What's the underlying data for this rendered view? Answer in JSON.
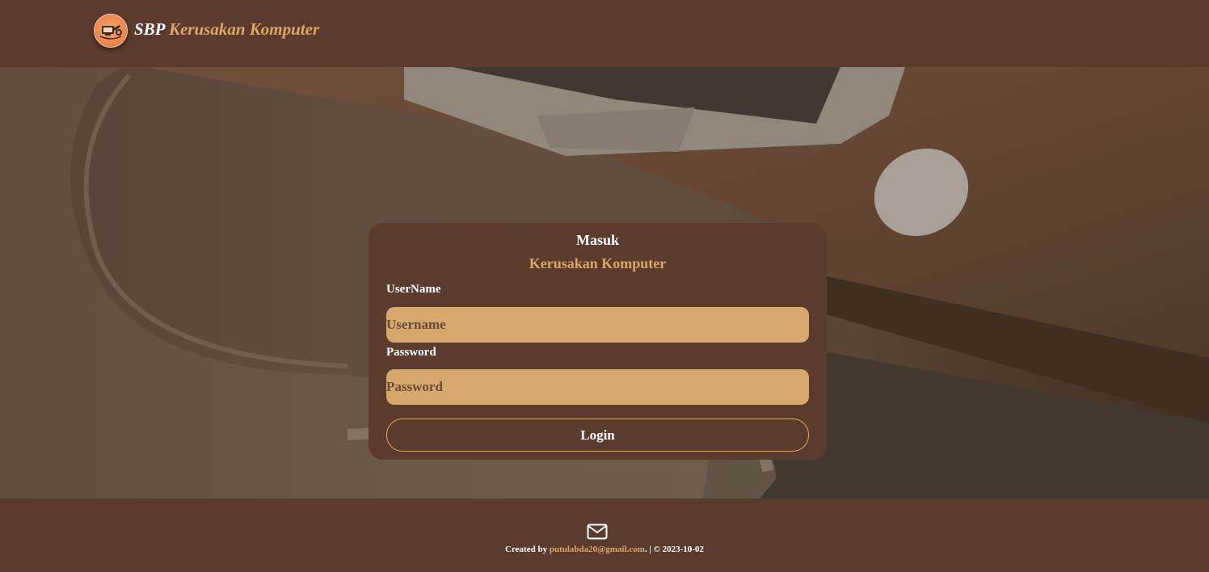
{
  "navbar": {
    "brand_bold": "SBP",
    "brand_rest": "Kerusakan Komputer",
    "logo_icon": "computer-repair-logo-icon"
  },
  "login": {
    "title": "Masuk",
    "subtitle": "Kerusakan Komputer",
    "username_label": "UserName",
    "username_placeholder": "Username",
    "username_value": "",
    "password_label": "Password",
    "password_placeholder": "Password",
    "password_value": "",
    "button_label": "Login"
  },
  "footer": {
    "icon": "envelope-icon",
    "created_by": "Created by",
    "email": "putulabda20@gmail.com",
    "after_email": ". | © 2023-10-02"
  },
  "colors": {
    "primary_brown": "#5b3b2c",
    "accent_tan": "#d9a86a",
    "input_bg": "#d5a86e",
    "text_white": "#ffffff"
  }
}
